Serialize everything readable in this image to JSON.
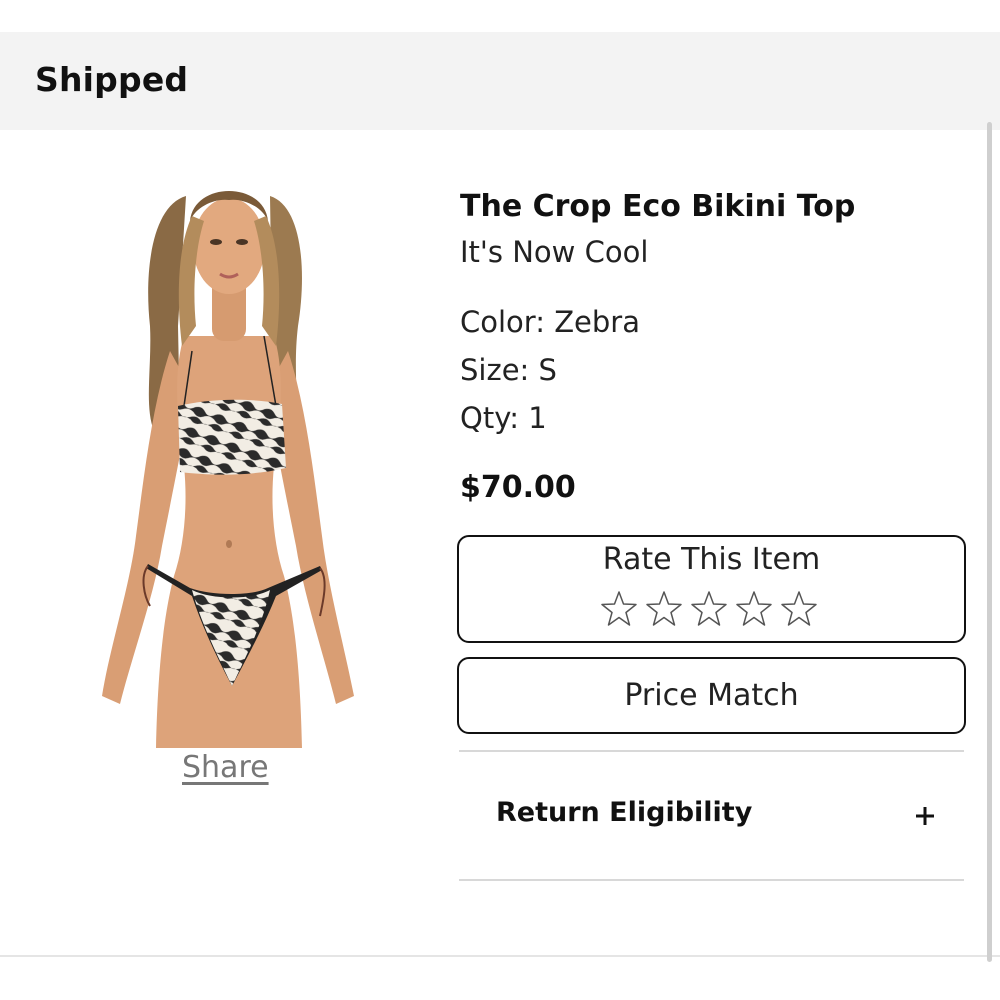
{
  "order": {
    "status_title": "Shipped"
  },
  "product": {
    "name": "The Crop Eco Bikini Top",
    "brand": "It's Now Cool",
    "color": "Color: Zebra",
    "size": "Size: S",
    "qty": "Qty: 1",
    "price": "$70.00",
    "image_icon": "product-photo",
    "share_label": "Share"
  },
  "rating": {
    "label": "Rate This Item",
    "stars_total": 5,
    "stars_filled": 0
  },
  "actions": {
    "price_match_label": "Price Match"
  },
  "returns": {
    "label": "Return Eligibility",
    "expand_icon": "plus-icon"
  },
  "colors": {
    "header_bg": "#f3f3f3",
    "text": "#111111",
    "link": "#777777",
    "border": "#111111",
    "divider": "#d8d8d8"
  }
}
